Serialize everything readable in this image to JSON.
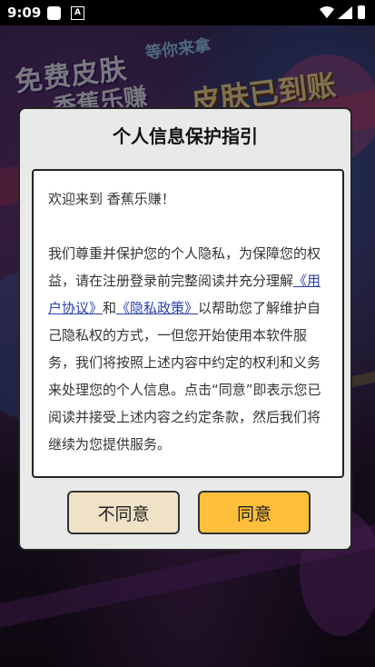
{
  "status_bar": {
    "time": "9:09",
    "notif_icon_letter": "A"
  },
  "background": {
    "headline_1": "免费皮肤",
    "headline_2": "等你来拿",
    "headline_3": "香蕉乐赚",
    "headline_4": "皮肤已到账"
  },
  "dialog": {
    "title": "个人信息保护指引",
    "welcome": "欢迎来到 香蕉乐赚！",
    "body_part1": "我们尊重并保护您的个人隐私，为保障您的权益，请在注册登录前完整阅读并充分理解",
    "user_agreement_link": "《用户协议》",
    "and_text": "和",
    "privacy_policy_link": "《隐私政策》",
    "body_part2": "以帮助您了解维护自己隐私权的方式，一但您开始使用本软件服务，我们将按照上述内容中约定的权利和义务来处理您的个人信息。点击“同意”即表示您已阅读并接受上述内容之约定条款，然后我们将继续为您提供服务。",
    "disagree_label": "不同意",
    "agree_label": "同意"
  },
  "colors": {
    "agree_button": "#ffbf3a",
    "disagree_button": "#efe2c6",
    "link": "#2a3fb0"
  }
}
